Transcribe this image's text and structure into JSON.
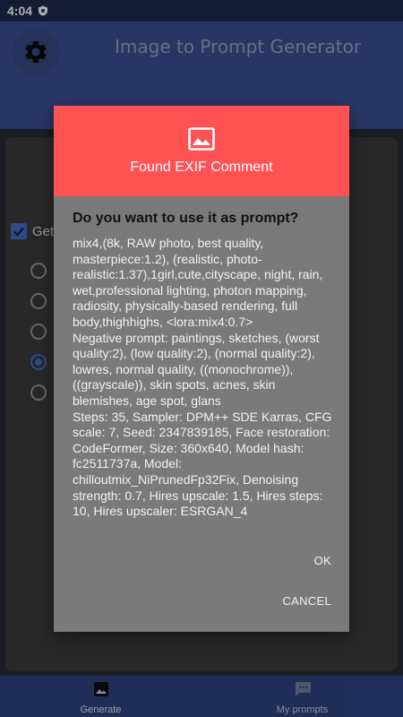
{
  "status_bar": {
    "time": "4:04"
  },
  "app": {
    "title": "Image to Prompt Generator"
  },
  "options": {
    "checkbox_label": "Get"
  },
  "bottom_nav": {
    "items": [
      {
        "label": "Generate",
        "icon": "image-icon"
      },
      {
        "label": "My prompts",
        "icon": "chat-icon"
      }
    ]
  },
  "dialog": {
    "icon": "image-icon",
    "title": "Found EXIF Comment",
    "question": "Do you want to use it as prompt?",
    "body": "mix4,(8k, RAW photo, best quality, masterpiece:1.2), (realistic, photo-realistic:1.37),1girl,cute,cityscape, night, rain, wet,professional lighting, photon mapping, radiosity, physically-based rendering, full body,thighhighs, <lora:mix4:0.7>\nNegative prompt: paintings, sketches, (worst quality:2), (low quality:2), (normal quality:2), lowres, normal quality, ((monochrome)), ((grayscale)), skin spots, acnes, skin blemishes, age spot, glans\nSteps: 35, Sampler: DPM++ SDE Karras, CFG scale: 7, Seed: 2347839185, Face restoration: CodeFormer, Size: 360x640, Model hash: fc2511737a, Model: chilloutmix_NiPrunedFp32Fix, Denoising strength: 0.7, Hires upscale: 1.5, Hires steps: 10, Hires upscaler: ESRGAN_4",
    "ok_label": "OK",
    "cancel_label": "CANCEL"
  },
  "colors": {
    "app_bar": "#3a5096",
    "status_bar": "#1e2a4e",
    "dialog_header": "#ff5252",
    "dialog_body": "#7a7a7a",
    "accent": "#3f6ed0",
    "bottom_nav": "#2e4484"
  }
}
